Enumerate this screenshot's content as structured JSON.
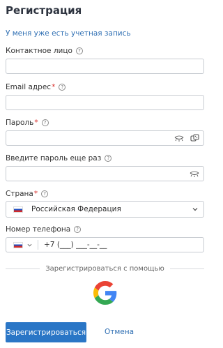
{
  "page": {
    "title": "Регистрация",
    "login_link": "У меня уже есть учетная запись"
  },
  "fields": {
    "contact": {
      "label": "Контактное лицо",
      "value": ""
    },
    "email": {
      "label": "Email адрес",
      "required_mark": "*",
      "value": ""
    },
    "password": {
      "label": "Пароль",
      "required_mark": "*",
      "value": ""
    },
    "password_repeat": {
      "label": "Введите пароль еще раз",
      "value": ""
    },
    "country": {
      "label": "Страна",
      "required_mark": "*",
      "selected": "Российская Федерация"
    },
    "phone": {
      "label": "Номер телефона",
      "mask": "+7 (___) ___-__-__"
    }
  },
  "help_icon": "?",
  "social": {
    "separator_text": "Зарегистрироваться с помощью",
    "providers": [
      "google-icon"
    ]
  },
  "actions": {
    "register_label": "Зарегистрироваться",
    "cancel_label": "Отмена"
  },
  "colors": {
    "link": "#2f6fb3",
    "primary": "#2a76c6",
    "required": "#d9322f",
    "border": "#c7cbd1"
  }
}
